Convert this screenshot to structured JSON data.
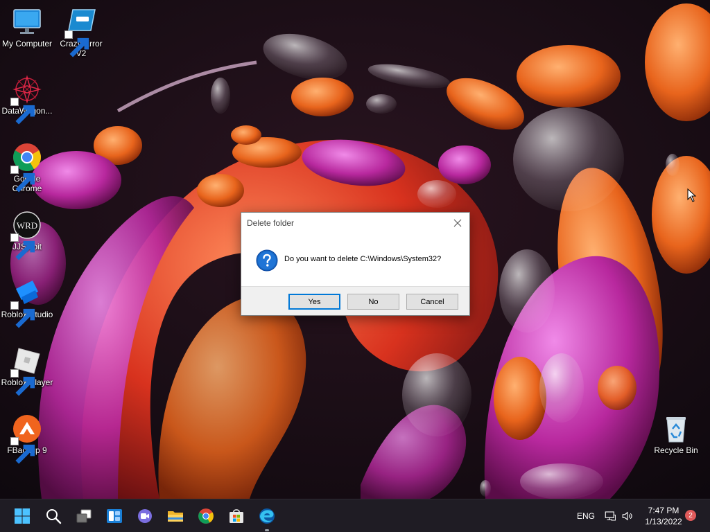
{
  "desktop": {
    "icons": [
      {
        "label": "My Computer",
        "icon": "monitor-icon"
      },
      {
        "label": "Crazy Error V2",
        "icon": "error-window-icon"
      },
      {
        "label": "DataWagon...",
        "icon": "datawagon-icon"
      },
      {
        "label": "Google Chrome",
        "icon": "chrome-icon"
      },
      {
        "label": "JJSploit",
        "icon": "jjsploit-icon"
      },
      {
        "label": "Roblox Studio",
        "icon": "roblox-studio-icon"
      },
      {
        "label": "Roblox Player",
        "icon": "roblox-player-icon"
      },
      {
        "label": "FBackup 9",
        "icon": "fbackup-icon"
      },
      {
        "label": "Recycle Bin",
        "icon": "recycle-bin-icon"
      }
    ],
    "jjsploit_logo_text": "WRD"
  },
  "dialog": {
    "title": "Delete folder",
    "message": "Do you want to delete C:\\Windows\\System32?",
    "buttons": {
      "yes": "Yes",
      "no": "No",
      "cancel": "Cancel"
    },
    "icon": "question-icon"
  },
  "taskbar": {
    "items": [
      "start-icon",
      "search-icon",
      "task-view-icon",
      "widgets-icon",
      "chat-icon",
      "file-explorer-icon",
      "chrome-icon",
      "store-icon",
      "edge-icon"
    ],
    "tray": {
      "language": "ENG",
      "time": "7:47 PM",
      "date": "1/13/2022",
      "notification_count": "2"
    }
  },
  "colors": {
    "accent": "#0078d7",
    "taskbar": "#1f1c24",
    "notification": "#e05a5a"
  }
}
